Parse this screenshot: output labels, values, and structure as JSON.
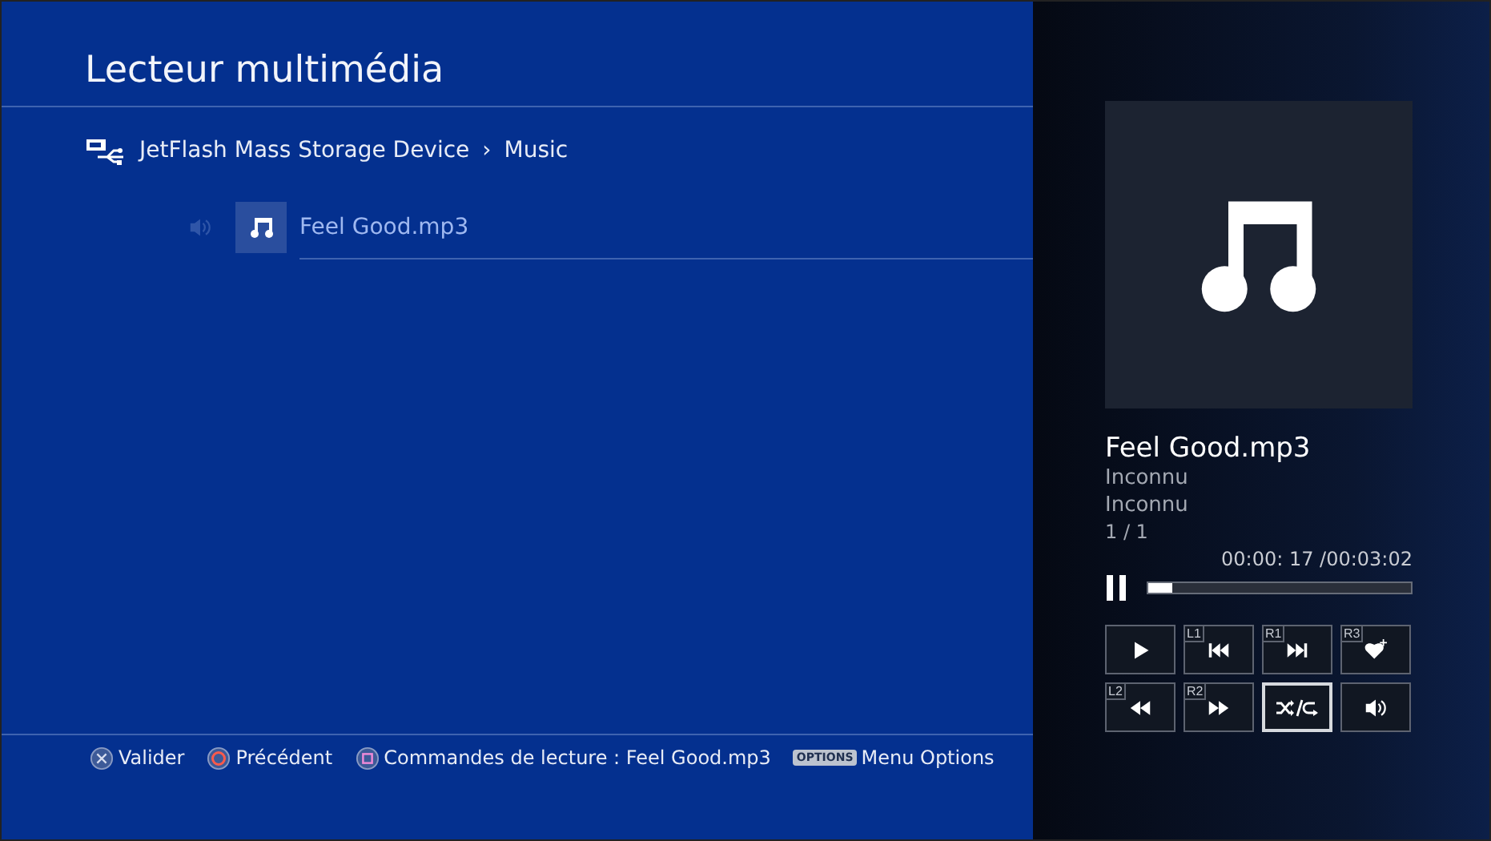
{
  "header": {
    "title": "Lecteur multimédia"
  },
  "breadcrumb": {
    "device": "JetFlash Mass Storage Device",
    "separator": "›",
    "folder": "Music"
  },
  "files": [
    {
      "name": "Feel Good.mp3",
      "selected": true
    }
  ],
  "footer": [
    {
      "kind": "cross",
      "label": "Valider"
    },
    {
      "kind": "circle",
      "label": "Précédent"
    },
    {
      "kind": "square",
      "label": "Commandes de lecture : Feel Good.mp3"
    },
    {
      "kind": "options",
      "badge": "OPTIONS",
      "label": "Menu Options"
    }
  ],
  "player": {
    "title": "Feel Good.mp3",
    "artist": "Inconnu",
    "album": "Inconnu",
    "track": "1 / 1",
    "time": "00:00: 17 /00:03:02",
    "progress": {
      "level": 0.09
    },
    "controls": [
      {
        "kind": "play",
        "selected": false
      },
      {
        "kind": "previous",
        "badge": "L1",
        "selected": false
      },
      {
        "kind": "next",
        "badge": "R1",
        "selected": false
      },
      {
        "kind": "favorite",
        "badge": "R3",
        "selected": false
      },
      {
        "kind": "rewind",
        "badge": "L2",
        "selected": false
      },
      {
        "kind": "forward",
        "badge": "R2",
        "selected": false
      },
      {
        "kind": "shuffle-repeat",
        "selected": true
      },
      {
        "kind": "volume",
        "selected": false
      }
    ]
  }
}
